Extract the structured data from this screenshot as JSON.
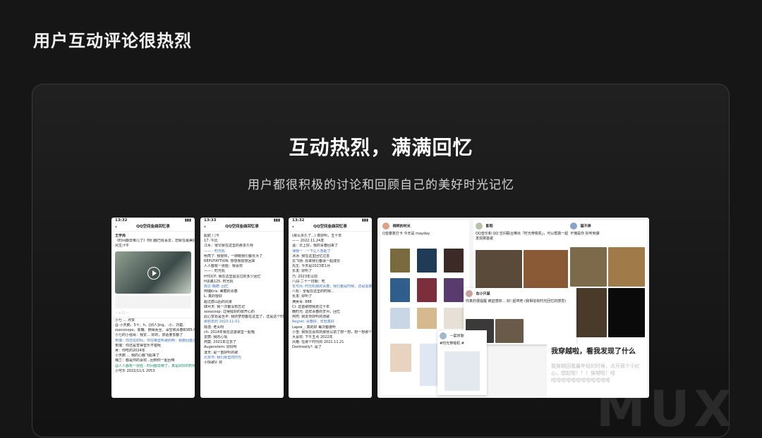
{
  "slide": {
    "title": "用户互动评论很热烈",
    "headline": "互动热烈，满满回忆",
    "subline": "用户都很积极的讨论和回顾自己的美好时光记忆",
    "watermark": "MUX"
  },
  "phones": [
    {
      "time": "13:32",
      "nav_title": "QQ空间金曲回忆录",
      "user": "王学亮",
      "post": "《时间都去哪儿了》你们都已经喜爱，您就在最美好的",
      "post2": "风生汗牛",
      "lines": [
        "小七 ... 点赞",
        "@ 小天鹅、5十、h、[别人]ing、.小、刘楚、",
        "zoococopo、陈曦、随缘而至、深空和青春B385人赞了",
        "小七的小强哥：我爱... 好的，旧话要去都了",
        "朱瑞：你还在的吗，你在哪里听歌的啊：我要回首过去...",
        "朱瑞：你还是觉得音乐不错呢",
        "吴：你吃的2024年",
        "小天鹅 ... 我的心都飞起来了",
        "梅兰：都是你的喜欢...回到你一起回味",
        "@人人都有一张脸 - 时间都去哪了，真是好好的时候",
        "小可乐 2022/11/1 2053"
      ]
    },
    {
      "time": "13:33",
      "nav_title": "QQ空间金曲回忆录",
      "lines": [
        "起航 门卡",
        "17: 牛比",
        "江水：很早就在这里的那多久呀",
        "——：时光机",
        "明亮了: 我很帅，一转眼我们都长大了",
        "REPUTAYTION: 想想我很想回来",
        "人人都有一张脸：我喜欢",
        "——：时光机",
        "HYDCP: 我在这里留言过的多少回忆",
        "H思路125: 时光机",
        "陈达·瑞德: 回忆",
        "阿瑞Kris: 美丽的青春",
        "L: 真的很好",
        "超过群山后的风景",
        "肆月天: 我一次都没有忘记",
        "xosocoop: 过得挺好的很开心的",
        "此心安处是吾乡: 我的梦想都在这里了，还是这个时候的音乐好听",
        "那些年的 2023-11-01",
        "陈逸: 老头呀",
        "ch: 2014年我在这首歌里一起唱",
        "爱丽: 我的心情",
        "阿莫: 2021年过去了",
        "Augenstern: 好好听",
        "凌天: 是一首好听的歌",
        "北京市: 我们那里的时光",
        "小情歌V: 好"
      ]
    },
    {
      "time": "13:32",
      "nav_title": "QQ空间金曲回忆录",
      "lines": [
        "(那么多久了...) 真好听，五十年",
        "—— 2022.11.24发",
        "温：早上好，我的青春回来了",
        "薄荷一 · 一下让人想起了",
        "冰冰: 我在这里回忆过去",
        "云飞扬: 原来我们都会一起成长",
        "先生: 今天是2023年1月",
        "长发: 好听了",
        "乃: 2023年以前",
        "八闯·二十一日期：吃",
        "花与风: 时光机我的青春，我们都是时候，还是需要去...",
        "八松：全程在这里的时候...",
        "长发: 好听了",
        "满吴青: 888",
        "Ci: 这首歌陪我走过十年",
        "晚时光: 这样青春的岁月，回忆",
        "阿然: 我爱你好听的旧歌",
        "Regret: 青春好，年轻真好",
        "Lapse_: 真的好 每次都要听",
        "小雪: 我现在喜欢的那些以前了想一想，想一想那个时候的音乐",
        "大喜欢: 下午五点 2022年",
        "风格: 在那个时代的 2021.11.21",
        "Dontreally?: 是了"
      ]
    }
  ],
  "collage": {
    "card1_user": "倒转的时光",
    "card1_text": "Q音康复打卡 今天是 mayday",
    "card2_user": "影阳",
    "card2_text": "QQ音乐和 QQ 空间联合推出「时光穿梭机」，可以帮助一起发现那首歌",
    "card3_user": "猫不停",
    "card3_text": "不愧是你 好听到爆",
    "card4_user": "在小只鼠",
    "card4_text": "你真的很提醒 被迫感叹... 好! 起哄死 (我相信有时光回忆的感觉)",
    "card5_user": "一起听歌",
    "card5_text": "#时光穿梭机 #",
    "big_caption": "我穿越啦，看我发现了什么",
    "faded_1": "我穿越回我最年轻的时候，点开那个小红",
    "faded_2": "心，想起啦！！！穿越啦！哈",
    "faded_3": "哈哈哈哈哈哈哈哈哈哈哈哈"
  }
}
